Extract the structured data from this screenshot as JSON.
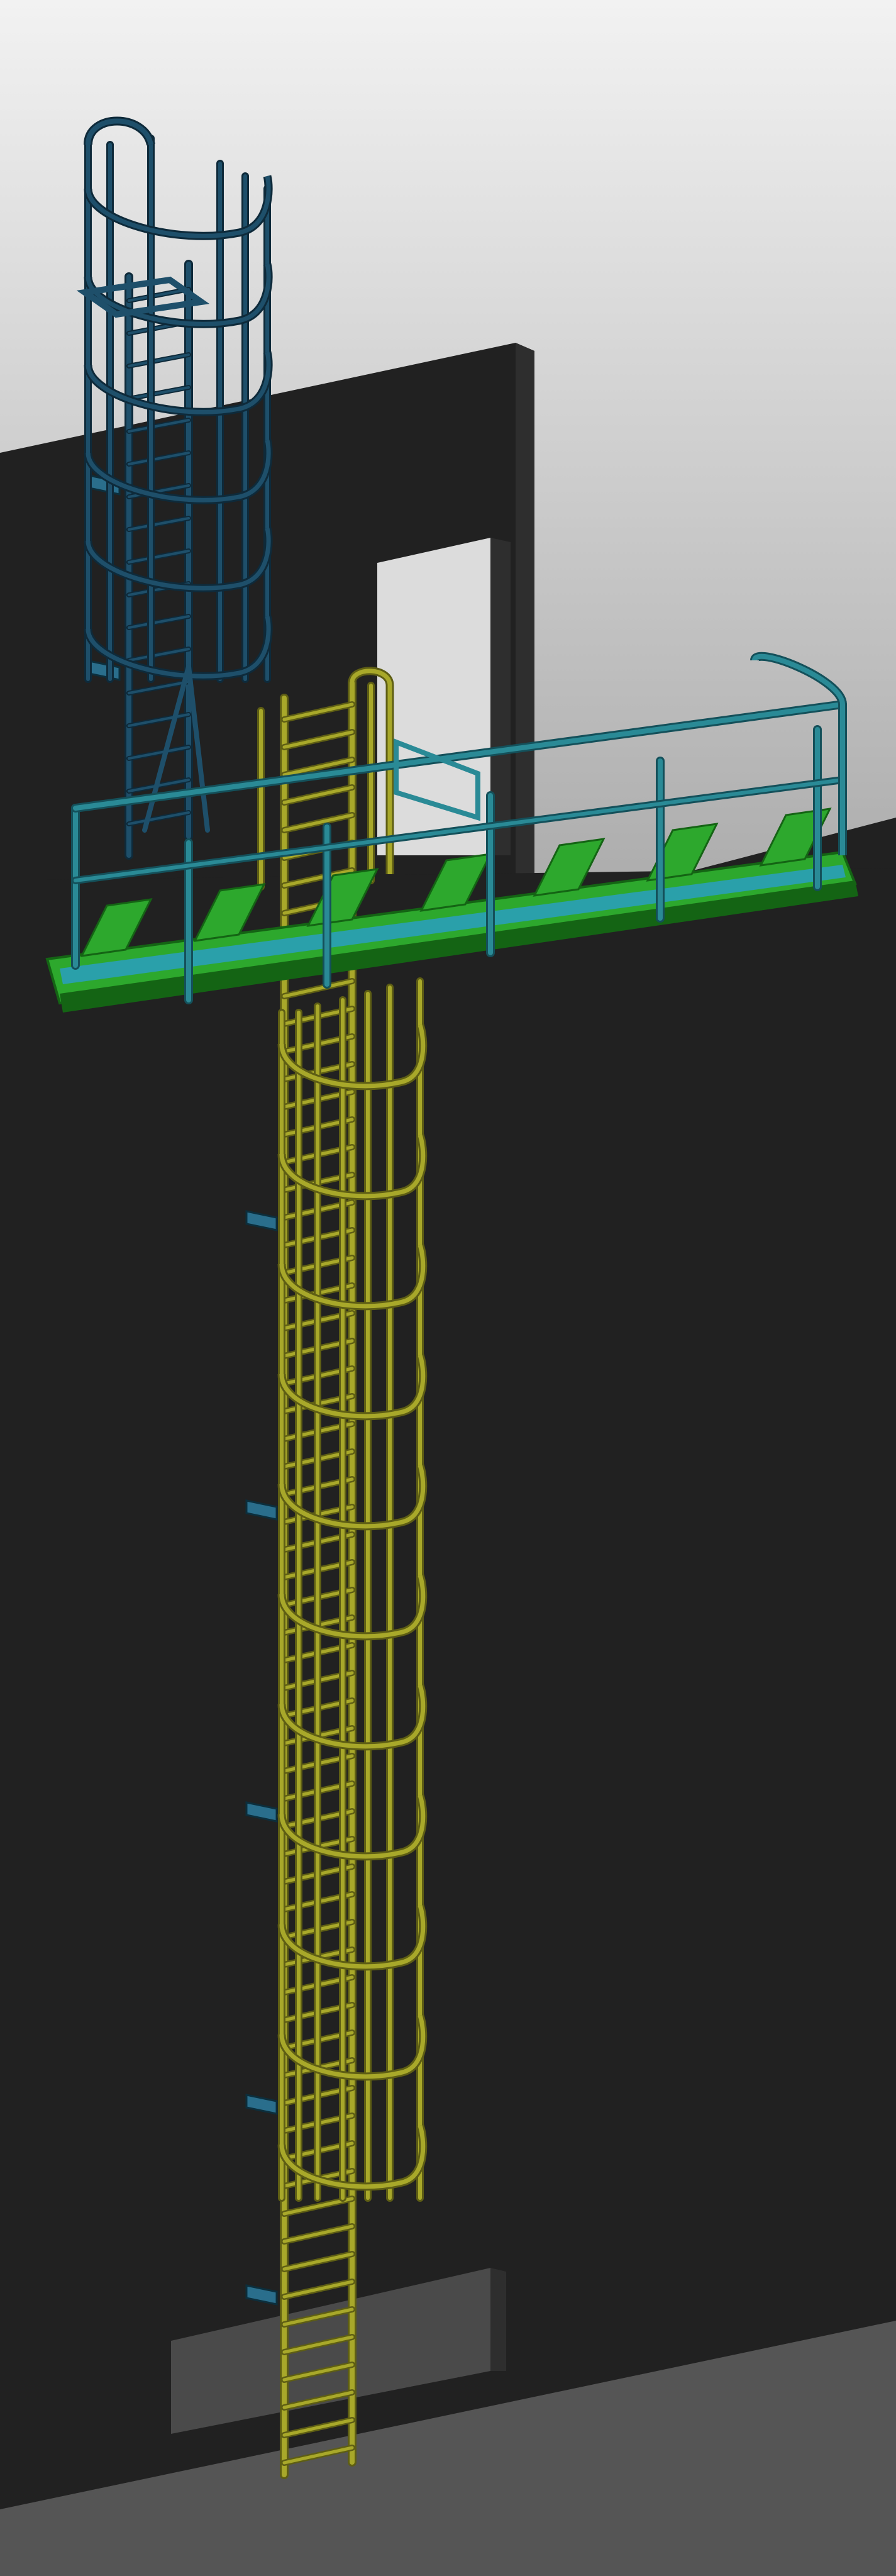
{
  "scene": {
    "subject": "caged-ladder-platform-model",
    "colors": {
      "sky_top": "#f2f2f2",
      "sky_bottom": "#a8a8a8",
      "wall_face": "#212121",
      "wall_side": "#2e2e2e",
      "wall_edge": "#3a3a3a",
      "floor": "#555555",
      "opening_light": "#dcdcdc",
      "opening_dark": "#4a4a4a",
      "ladder_yellow": "#a8a82a",
      "ladder_yellow_dark": "#5e5e14",
      "upper_ladder_blue": "#1e4f6a",
      "upper_ladder_blue_dark": "#0e2a3a",
      "railing_teal": "#2a8a96",
      "railing_teal_dark": "#14505a",
      "platform_green": "#2da82d",
      "platform_green_dark": "#146414",
      "platform_teal": "#2aa0aa",
      "bracket_blue": "#2a6e8c"
    }
  }
}
